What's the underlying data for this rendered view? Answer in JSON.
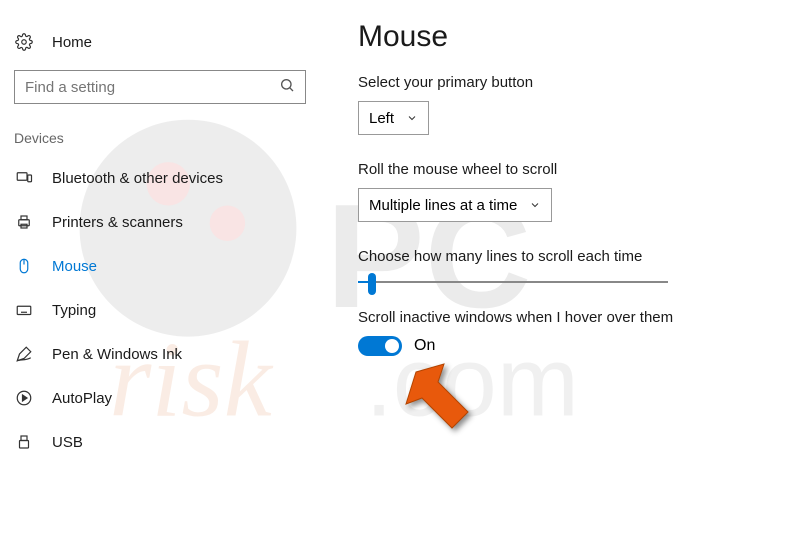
{
  "sidebar": {
    "home_label": "Home",
    "search_placeholder": "Find a setting",
    "section_label": "Devices",
    "items": [
      {
        "label": "Bluetooth & other devices"
      },
      {
        "label": "Printers & scanners"
      },
      {
        "label": "Mouse"
      },
      {
        "label": "Typing"
      },
      {
        "label": "Pen & Windows Ink"
      },
      {
        "label": "AutoPlay"
      },
      {
        "label": "USB"
      }
    ]
  },
  "content": {
    "title": "Mouse",
    "primary_button": {
      "label": "Select your primary button",
      "value": "Left"
    },
    "wheel_scroll": {
      "label": "Roll the mouse wheel to scroll",
      "value": "Multiple lines at a time"
    },
    "lines_label": "Choose how many lines to scroll each time",
    "inactive_scroll": {
      "label": "Scroll inactive windows when I hover over them",
      "state": "On"
    }
  }
}
